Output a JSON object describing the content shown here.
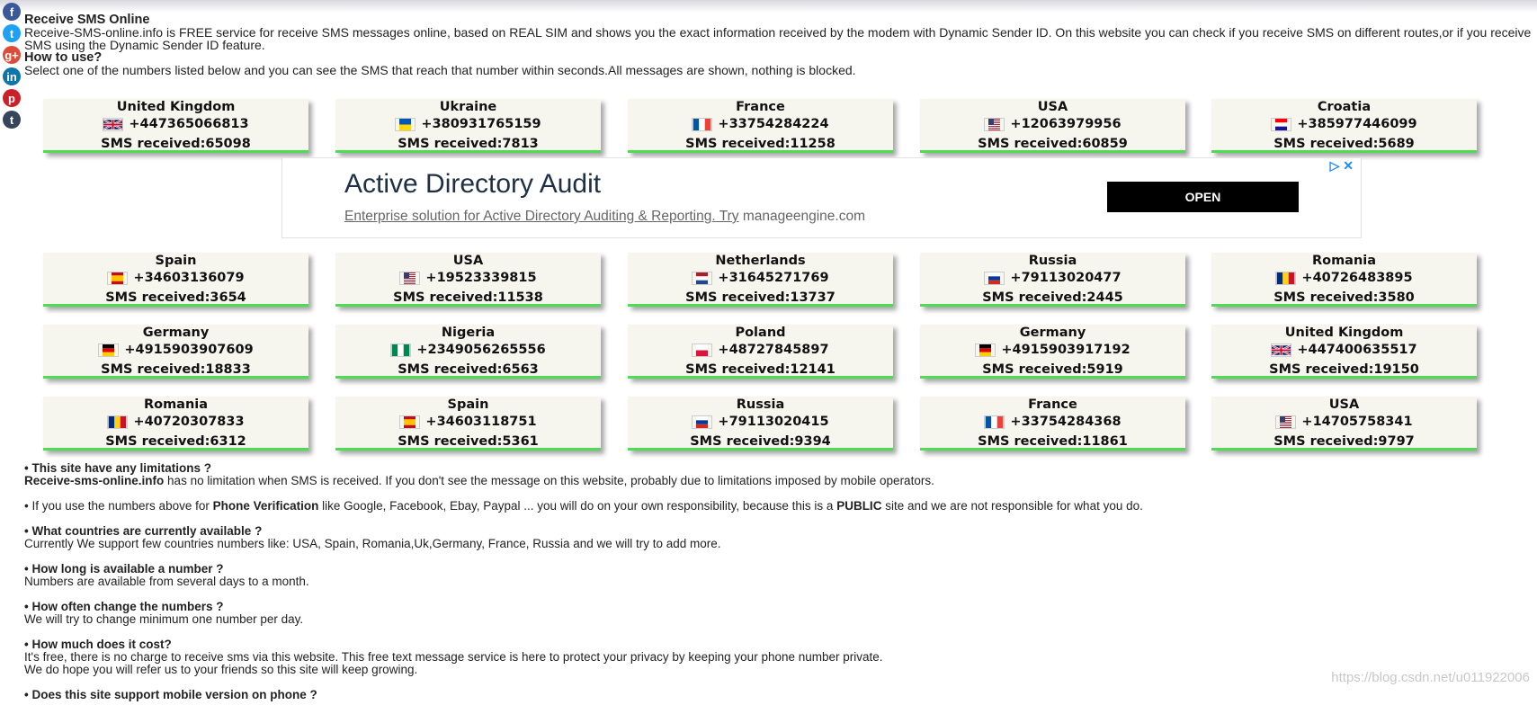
{
  "intro": {
    "title": "Receive SMS Online",
    "description": "Receive-SMS-online.info is FREE service for receive SMS messages online, based on REAL SIM and shows you the exact information received by the modem with Dynamic Sender ID. On this website you can check if you receive SMS on different routes,or if you receive SMS using the Dynamic Sender ID feature.",
    "howto_title": "How to use?",
    "howto_text": "Select one of the numbers listed below and you can see the SMS that reach that number within seconds.All messages are shown, nothing is blocked."
  },
  "social": [
    {
      "icon": "facebook-icon",
      "glyph": "f",
      "color": "#3b5998"
    },
    {
      "icon": "twitter-icon",
      "glyph": "t",
      "color": "#1da1f2"
    },
    {
      "icon": "google-plus-icon",
      "glyph": "g+",
      "color": "#dd4b39"
    },
    {
      "icon": "linkedin-icon",
      "glyph": "in",
      "color": "#0e76a8"
    },
    {
      "icon": "pinterest-icon",
      "glyph": "p",
      "color": "#cb2027"
    },
    {
      "icon": "tumblr-icon",
      "glyph": "t",
      "color": "#35465c"
    }
  ],
  "numbers": [
    {
      "country": "United Kingdom",
      "number": "+447365066813",
      "received": "SMS received:65098",
      "flag": "uk"
    },
    {
      "country": "Ukraine",
      "number": "+380931765159",
      "received": "SMS received:7813",
      "flag": "ua"
    },
    {
      "country": "France",
      "number": "+33754284224",
      "received": "SMS received:11258",
      "flag": "fr"
    },
    {
      "country": "USA",
      "number": "+12063979956",
      "received": "SMS received:60859",
      "flag": "us"
    },
    {
      "country": "Croatia",
      "number": "+385977446099",
      "received": "SMS received:5689",
      "flag": "hr"
    },
    {
      "country": "Spain",
      "number": "+34603136079",
      "received": "SMS received:3654",
      "flag": "es"
    },
    {
      "country": "USA",
      "number": "+19523339815",
      "received": "SMS received:11538",
      "flag": "us"
    },
    {
      "country": "Netherlands",
      "number": "+31645271769",
      "received": "SMS received:13737",
      "flag": "nl"
    },
    {
      "country": "Russia",
      "number": "+79113020477",
      "received": "SMS received:2445",
      "flag": "ru"
    },
    {
      "country": "Romania",
      "number": "+40726483895",
      "received": "SMS received:3580",
      "flag": "ro"
    },
    {
      "country": "Germany",
      "number": "+4915903907609",
      "received": "SMS received:18833",
      "flag": "de"
    },
    {
      "country": "Nigeria",
      "number": "+2349056265556",
      "received": "SMS received:6563",
      "flag": "ng"
    },
    {
      "country": "Poland",
      "number": "+48727845897",
      "received": "SMS received:12141",
      "flag": "pl"
    },
    {
      "country": "Germany",
      "number": "+4915903917192",
      "received": "SMS received:5919",
      "flag": "de"
    },
    {
      "country": "United Kingdom",
      "number": "+447400635517",
      "received": "SMS received:19150",
      "flag": "uk"
    },
    {
      "country": "Romania",
      "number": "+40720307833",
      "received": "SMS received:6312",
      "flag": "ro"
    },
    {
      "country": "Spain",
      "number": "+34603118751",
      "received": "SMS received:5361",
      "flag": "es"
    },
    {
      "country": "Russia",
      "number": "+79113020415",
      "received": "SMS received:9394",
      "flag": "ru"
    },
    {
      "country": "France",
      "number": "+33754284368",
      "received": "SMS received:11861",
      "flag": "fr"
    },
    {
      "country": "USA",
      "number": "+14705758341",
      "received": "SMS received:9797",
      "flag": "us"
    }
  ],
  "ad": {
    "title": "Active Directory Audit",
    "desc": "Enterprise solution for Active Directory Auditing & Reporting. Try",
    "domain": "manageengine.com",
    "button": "OPEN"
  },
  "faq": {
    "q1": "• This site have any limitations ?",
    "a1_bold": "Receive-sms-online.info",
    "a1": " has no limitation when SMS is received. If you don't see the message on this website, probably due to limitations imposed by mobile operators.",
    "p2_a": "• If you use the numbers above for ",
    "p2_b": "Phone Verification",
    "p2_c": " like Google, Facebook, Ebay, Paypal ... you will do on your own responsibility, because this is a ",
    "p2_d": "PUBLIC",
    "p2_e": " site and we are not responsible for what you do.",
    "q3": "• What countries are currently available ?",
    "a3": "Currently We support few countries numbers like: USA, Spain, Romania,Uk,Germany, France, Russia and we will try to add more.",
    "q4": "• How long is available a number ?",
    "a4": "Numbers are available from several days to a month.",
    "q5": "• How often change the numbers ?",
    "a5": "We will try to change minimum one number per day.",
    "q6": "• How much does it cost?",
    "a6": "It's free, there is no charge to receive sms via this website. This free text message service is here to protect your privacy by keeping your phone number private.",
    "a6b": "We do hope you will refer us to your friends so this site will keep growing.",
    "q7": "• Does this site support mobile version on phone ?"
  },
  "watermark": "https://blog.csdn.net/u011922006",
  "colors": {
    "card_bg": "#f6f5ee",
    "card_border": "#4fdc55",
    "ad_button": "#000000",
    "ad_choice": "#1a8cff"
  }
}
